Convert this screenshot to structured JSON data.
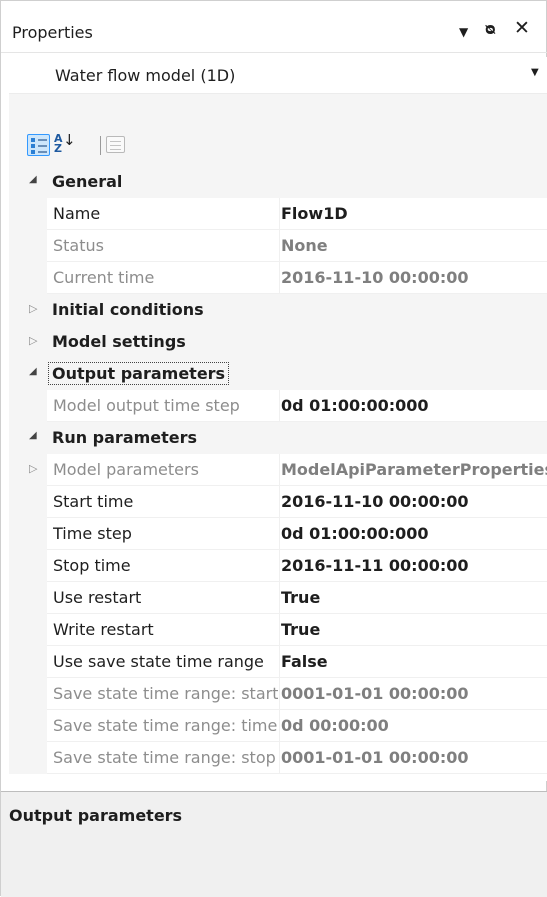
{
  "window": {
    "title": "Properties",
    "buttons": {
      "dropdown_icon": "▼",
      "pin_icon": "⊥",
      "close_icon": "✕"
    }
  },
  "object_selector": {
    "value": "Water flow model (1D)"
  },
  "toolbar": {
    "categorized_icon": "categorized-view-icon",
    "alphabetical_icon": "sort-az-icon",
    "property_pages_icon": "property-pages-icon"
  },
  "grid": {
    "general": {
      "label": "General",
      "rows": [
        {
          "name": "Name",
          "value": "Flow1D"
        },
        {
          "name": "Status",
          "value": "None"
        },
        {
          "name": "Current time",
          "value": "2016-11-10 00:00:00"
        }
      ]
    },
    "initial_conditions": {
      "label": "Initial conditions"
    },
    "model_settings": {
      "label": "Model settings"
    },
    "output_parameters": {
      "label": "Output parameters",
      "rows": [
        {
          "name": "Model output time step",
          "value": "0d 01:00:00:000"
        }
      ]
    },
    "run_parameters": {
      "label": "Run parameters",
      "rows": [
        {
          "name": "Model parameters",
          "value": "ModelApiParameterProperties"
        },
        {
          "name": "Start time",
          "value": "2016-11-10 00:00:00"
        },
        {
          "name": "Time step",
          "value": "0d 01:00:00:000"
        },
        {
          "name": "Stop time",
          "value": "2016-11-11 00:00:00"
        },
        {
          "name": "Use restart",
          "value": "True"
        },
        {
          "name": "Write restart",
          "value": "True"
        },
        {
          "name": "Use save state time range",
          "value": "False"
        },
        {
          "name": "Save state time range: start",
          "value": "0001-01-01 00:00:00"
        },
        {
          "name": "Save state time range: time step",
          "value": "0d 00:00:00"
        },
        {
          "name": "Save state time range: stop",
          "value": "0001-01-01 00:00:00"
        }
      ]
    }
  },
  "description": {
    "title": "Output parameters"
  }
}
